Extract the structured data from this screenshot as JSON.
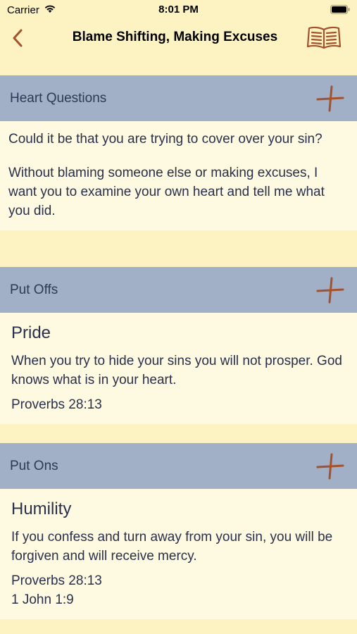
{
  "status_bar": {
    "carrier": "Carrier",
    "time": "8:01 PM"
  },
  "nav": {
    "title": "Blame Shifting, Making Excuses",
    "back_icon": "chevron-left-icon",
    "book_icon": "open-book-icon",
    "accent_color": "#a3522c"
  },
  "heart_questions": {
    "header": "Heart Questions",
    "paragraphs": [
      "Could it be that you are trying to cover over your sin?",
      "Without blaming someone else or making excuses, I want you to examine your own heart and tell me what you did."
    ]
  },
  "put_offs": {
    "header": "Put Offs",
    "entries": [
      {
        "title": "Pride",
        "description": "When you try to hide your sins you will not prosper. God knows what is in your heart.",
        "references": [
          "Proverbs 28:13"
        ]
      }
    ]
  },
  "put_ons": {
    "header": "Put Ons",
    "entries": [
      {
        "title": "Humility",
        "description": "If you confess and turn away from your sin, you will be forgiven and will receive mercy.",
        "references": [
          "Proverbs 28:13",
          "1 John 1:9"
        ]
      }
    ]
  },
  "colors": {
    "background": "#fdf3c2",
    "section_header": "#a1afc7",
    "section_body": "#fefae2",
    "plus_icon": "#a3522c"
  }
}
